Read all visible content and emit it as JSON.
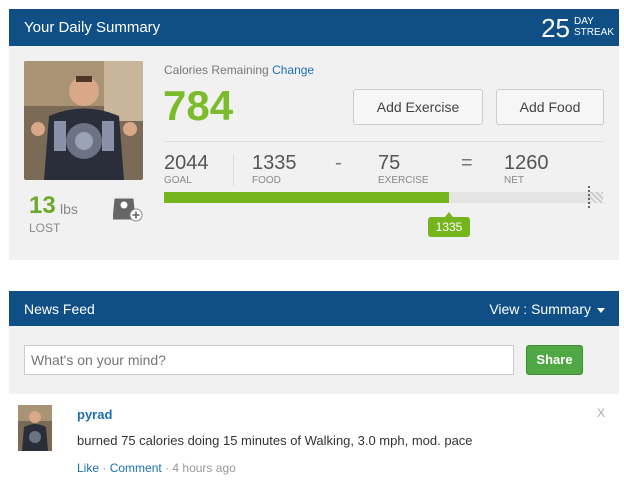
{
  "summary": {
    "title": "Your Daily Summary",
    "streak_number": "25",
    "streak_label_1": "DAY",
    "streak_label_2": "STREAK",
    "weight_lost_value": "13",
    "weight_lost_unit": "lbs",
    "weight_lost_label": "LOST",
    "calories_remaining_label": "Calories Remaining",
    "change_link": "Change",
    "calories_remaining": "784",
    "add_exercise_label": "Add Exercise",
    "add_food_label": "Add Food",
    "goal_value": "2044",
    "goal_label": "GOAL",
    "food_value": "1335",
    "food_label": "FOOD",
    "minus_symbol": "-",
    "exercise_value": "75",
    "exercise_label": "EXERCISE",
    "equals_symbol": "=",
    "net_value": "1260",
    "net_label": "NET",
    "progress_label": "1335",
    "progress_fraction": 0.65,
    "accent_color": "#7cbc2a",
    "header_color": "#0f4f86"
  },
  "feed": {
    "title": "News Feed",
    "view_label": "View : Summary",
    "status_placeholder": "What's on your mind?",
    "share_label": "Share",
    "post": {
      "username": "pyrad",
      "close_symbol": "X",
      "text": "burned 75 calories doing 15 minutes of Walking, 3.0 mph, mod. pace",
      "like_label": "Like",
      "separator_1": "·",
      "comment_label": "Comment",
      "separator_2": "·",
      "timestamp": "4 hours ago"
    }
  }
}
